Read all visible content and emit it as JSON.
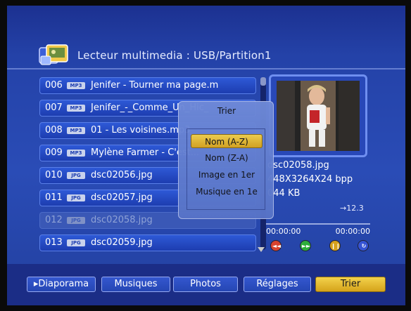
{
  "header": {
    "title": "Lecteur multimedia : USB/Partition1"
  },
  "files": [
    {
      "num": "006",
      "type": "MP3",
      "name": "Jenifer - Tourner ma page.m",
      "dim": false
    },
    {
      "num": "007",
      "type": "MP3",
      "name": "Jenifer_-_Comme_Un_Hic_",
      "dim": false
    },
    {
      "num": "008",
      "type": "MP3",
      "name": "01 - Les voisines.mp3",
      "dim": false
    },
    {
      "num": "009",
      "type": "MP3",
      "name": "Mylène Farmer - C'est...",
      "dim": false
    },
    {
      "num": "010",
      "type": "JPG",
      "name": "dsc02056.jpg",
      "dim": false
    },
    {
      "num": "011",
      "type": "JPG",
      "name": "dsc02057.jpg",
      "dim": false
    },
    {
      "num": "012",
      "type": "JPG",
      "name": "dsc02058.jpg",
      "dim": true
    },
    {
      "num": "013",
      "type": "JPG",
      "name": "dsc02059.jpg",
      "dim": false
    }
  ],
  "info": {
    "filename": "dsc02058.jpg",
    "dimensions": "448X3264X24 bpp",
    "size": "044 KB",
    "counter": "→12.3",
    "time_elapsed": "00:00:00",
    "time_total": "00:00:00"
  },
  "sort_dialog": {
    "title": "Trier",
    "options": [
      {
        "label": "Nom (A-Z)",
        "selected": true
      },
      {
        "label": "Nom (Z-A)",
        "selected": false
      },
      {
        "label": "Image en 1er",
        "selected": false
      },
      {
        "label": "Musique en 1e",
        "selected": false
      }
    ]
  },
  "controls": [
    {
      "icon": "rewind-icon",
      "color": "#d8432f",
      "sym": "◄◄"
    },
    {
      "icon": "fast-forward-icon",
      "color": "#2fae3b",
      "sym": "►►"
    },
    {
      "icon": "pause-icon",
      "color": "#d6a01c",
      "sym": "❙❙"
    },
    {
      "icon": "repeat-icon",
      "color": "#3553d3",
      "sym": "↻"
    }
  ],
  "menu": [
    {
      "label": "▸Diaporama",
      "active": false
    },
    {
      "label": "Musiques",
      "active": false
    },
    {
      "label": "Photos",
      "active": false
    },
    {
      "label": "Réglages",
      "active": false
    },
    {
      "label": "Trier",
      "active": true
    }
  ]
}
